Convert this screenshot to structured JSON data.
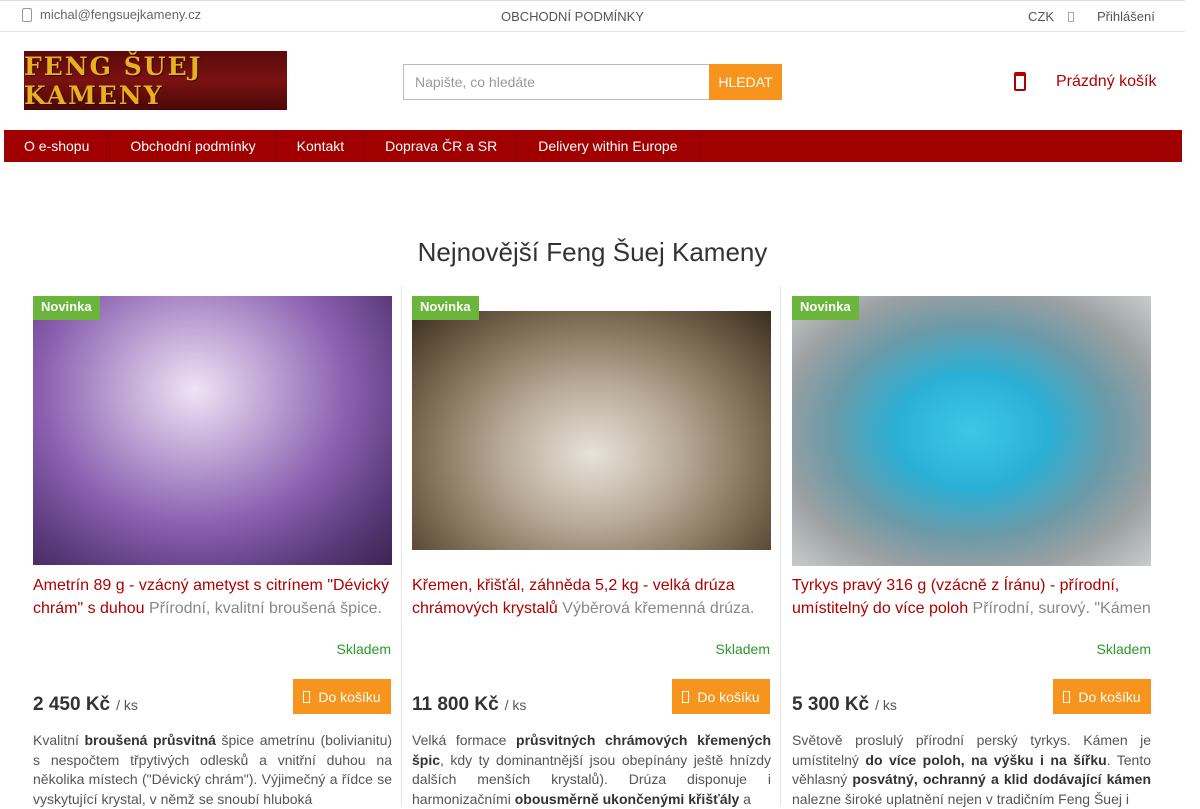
{
  "topbar": {
    "email": "michal@fengsuejkameny.cz",
    "terms": "OBCHODNÍ PODMÍNKY",
    "currency": "CZK",
    "login": "Přihlášení"
  },
  "header": {
    "logo_text": "FENG ŠUEJ KAMENY",
    "search_placeholder": "Napište, co hledáte",
    "search_button": "Hledat",
    "cart_label": "Prázdný košík"
  },
  "nav": {
    "items": [
      "O e-shopu",
      "Obchodní podmínky",
      "Kontakt",
      "Doprava ČR a SR",
      "Delivery within Europe"
    ]
  },
  "main": {
    "heading": "Nejnovější Feng Šuej Kameny"
  },
  "products": [
    {
      "badge": "Novinka",
      "name": "Ametrín 89 g - vzácný ametyst s citrínem \"Dévický chrám\" s duhou",
      "short_desc": "Přírodní, kvalitní broušená špice.",
      "stock": "Skladem",
      "price": "2 450 Kč",
      "unit": "/ ks",
      "buy_label": "Do košíku",
      "blurb_1": "Kvalitní",
      "blurb_2": "broušená průsvitná",
      "blurb_3": "špice ametrínu (bolivianitu) s nespočtem třpytivých odlesků a vnitřní duhou na několika místech (\"Dévický chrám\"). Výjimečný a řídce se vyskytující krystal, v němž se snoubí hluboká"
    },
    {
      "badge": "Novinka",
      "name": "Křemen, křišťál, záhněda 5,2 kg - velká drúza chrámových krystalů",
      "short_desc": "Výběrová křemenná drúza.",
      "stock": "Skladem",
      "price": "11 800 Kč",
      "unit": "/ ks",
      "buy_label": "Do košíku",
      "blurb_1": "Velká formace",
      "blurb_2": "průsvitných chrámových křemených špic",
      "blurb_3": ", kdy ty dominantnější jsou obepínány ještě hnízdy dalších menších krystalů). Drúza disponuje i harmonizačními",
      "blurb_4": "obousměrně ukončenými křišťály",
      "blurb_5": "a"
    },
    {
      "badge": "Novinka",
      "name": "Tyrkys pravý 316 g (vzácně z Íránu) - přírodní, umístitelný do více poloh",
      "short_desc": "Přírodní, surový. \"Kámen",
      "stock": "Skladem",
      "price": "5 300 Kč",
      "unit": "/ ks",
      "buy_label": "Do košíku",
      "blurb_1": "Světově proslulý přírodní perský tyrkys. Kámen je umístitelný",
      "blurb_2": "do více poloh, na výšku i na šířku",
      "blurb_3": ". Tento věhlasný",
      "blurb_4": "posvátný, ochranný a klid dodávající kámen",
      "blurb_5": "nalezne široké uplatnění nejen v tradičním Feng Šuej i"
    }
  ],
  "colors": {
    "brand_red": "#a00000",
    "accent_orange": "#f7941d",
    "badge_green": "#6bb53c",
    "stock_green": "#2a9a2a"
  }
}
